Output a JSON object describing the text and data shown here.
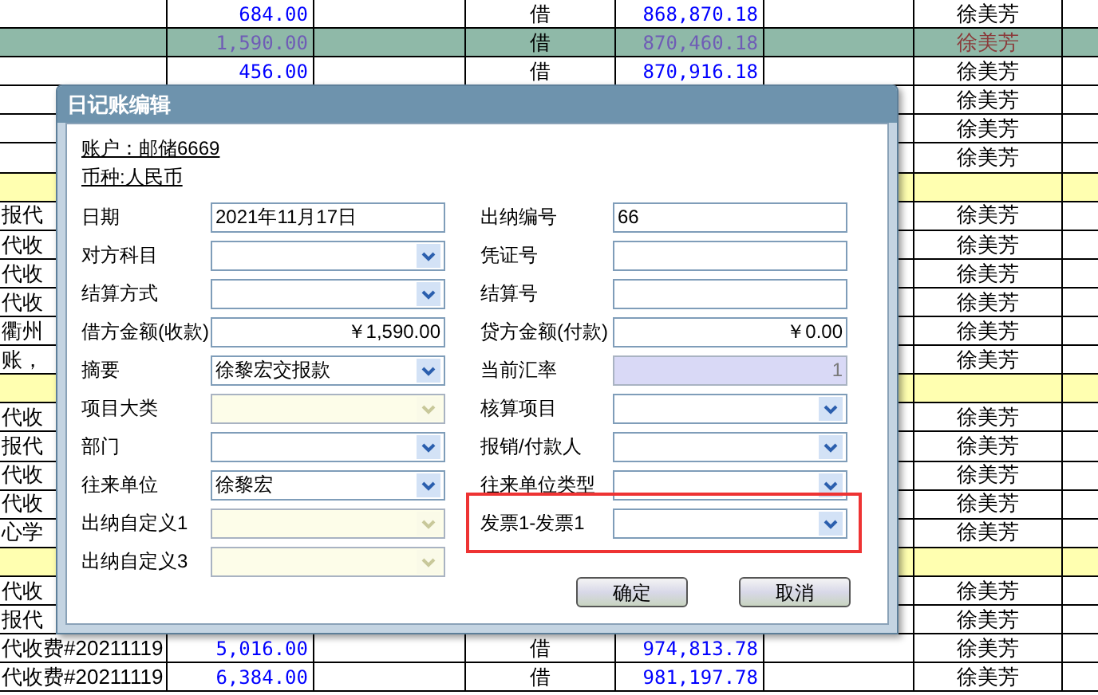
{
  "table": {
    "rows": [
      {
        "kind": "normal",
        "amount": "684.00",
        "dc": "借",
        "balance": "868,870.18",
        "name": "徐美芳"
      },
      {
        "kind": "selected",
        "amount": "1,590.00",
        "dc": "借",
        "balance": "870,460.18",
        "name": "徐美芳"
      },
      {
        "kind": "normal",
        "amount": "456.00",
        "dc": "借",
        "balance": "870,916.18",
        "name": "徐美芳"
      },
      {
        "kind": "normal",
        "name": "徐美芳"
      },
      {
        "kind": "normal",
        "name": "徐美芳"
      },
      {
        "kind": "normal",
        "name": "徐美芳"
      },
      {
        "kind": "highlight"
      },
      {
        "kind": "normal",
        "c1": "报代",
        "name": "徐美芳"
      },
      {
        "kind": "normal",
        "c1": "代收",
        "name": "徐美芳"
      },
      {
        "kind": "normal",
        "c1": "代收",
        "name": "徐美芳"
      },
      {
        "kind": "normal",
        "c1": "代收",
        "name": "徐美芳"
      },
      {
        "kind": "normal",
        "c1": "衢州",
        "name": "徐美芳"
      },
      {
        "kind": "normal",
        "c1": "账，",
        "name": "徐美芳"
      },
      {
        "kind": "highlight"
      },
      {
        "kind": "normal",
        "c1": "代收",
        "name": "徐美芳"
      },
      {
        "kind": "normal",
        "c1": "报代",
        "name": "徐美芳"
      },
      {
        "kind": "normal",
        "c1": "代收",
        "name": "徐美芳"
      },
      {
        "kind": "normal",
        "c1": "代收",
        "name": "徐美芳"
      },
      {
        "kind": "normal",
        "c1": "心学",
        "name": "徐美芳"
      },
      {
        "kind": "highlight"
      },
      {
        "kind": "normal",
        "c1": "代收",
        "name": "徐美芳"
      },
      {
        "kind": "normal",
        "c1": "报代",
        "name": "徐美芳"
      },
      {
        "kind": "normal",
        "c1": "代收费#20211119",
        "amount": "5,016.00",
        "dc": "借",
        "balance": "974,813.78",
        "name": "徐美芳"
      },
      {
        "kind": "normal",
        "c1": "代收费#20211119",
        "amount": "6,384.00",
        "dc": "借",
        "balance": "981,197.78",
        "name": "徐美芳"
      }
    ]
  },
  "dialog": {
    "title": "日记账编辑",
    "account": "账户：邮储6669",
    "currency": "币种:人民币",
    "left_fields": [
      {
        "label": "日期",
        "value": "2021年11月17日",
        "kind": "text"
      },
      {
        "label": "对方科目",
        "kind": "combo"
      },
      {
        "label": "结算方式",
        "kind": "combo"
      },
      {
        "label": "借方金额(收款)",
        "value": "￥1,590.00",
        "kind": "amount"
      },
      {
        "label": "摘要",
        "value": "徐黎宏交报款",
        "kind": "combo"
      },
      {
        "label": "项目大类",
        "kind": "combo_disabled"
      },
      {
        "label": "部门",
        "kind": "combo"
      },
      {
        "label": "往来单位",
        "value": "徐黎宏",
        "kind": "combo"
      },
      {
        "label": "出纳自定义1",
        "kind": "combo_disabled"
      },
      {
        "label": "出纳自定义3",
        "kind": "combo_disabled"
      }
    ],
    "right_fields": [
      {
        "label": "出纳编号",
        "value": "66",
        "kind": "text",
        "highlighted": false
      },
      {
        "label": "凭证号",
        "kind": "text",
        "highlighted": false
      },
      {
        "label": "结算号",
        "kind": "text",
        "highlighted": false
      },
      {
        "label": "贷方金额(付款)",
        "value": "￥0.00",
        "kind": "amount",
        "highlighted": false
      },
      {
        "label": "当前汇率",
        "value": "1",
        "kind": "readonly",
        "highlighted": false
      },
      {
        "label": "核算项目",
        "kind": "combo",
        "highlighted": false
      },
      {
        "label": "报销/付款人",
        "kind": "combo",
        "highlighted": false
      },
      {
        "label": "往来单位类型",
        "kind": "combo",
        "highlighted": false
      },
      {
        "label": "发票1-发票1",
        "kind": "combo",
        "highlighted": true
      }
    ],
    "buttons": [
      "确定",
      "取消"
    ]
  }
}
